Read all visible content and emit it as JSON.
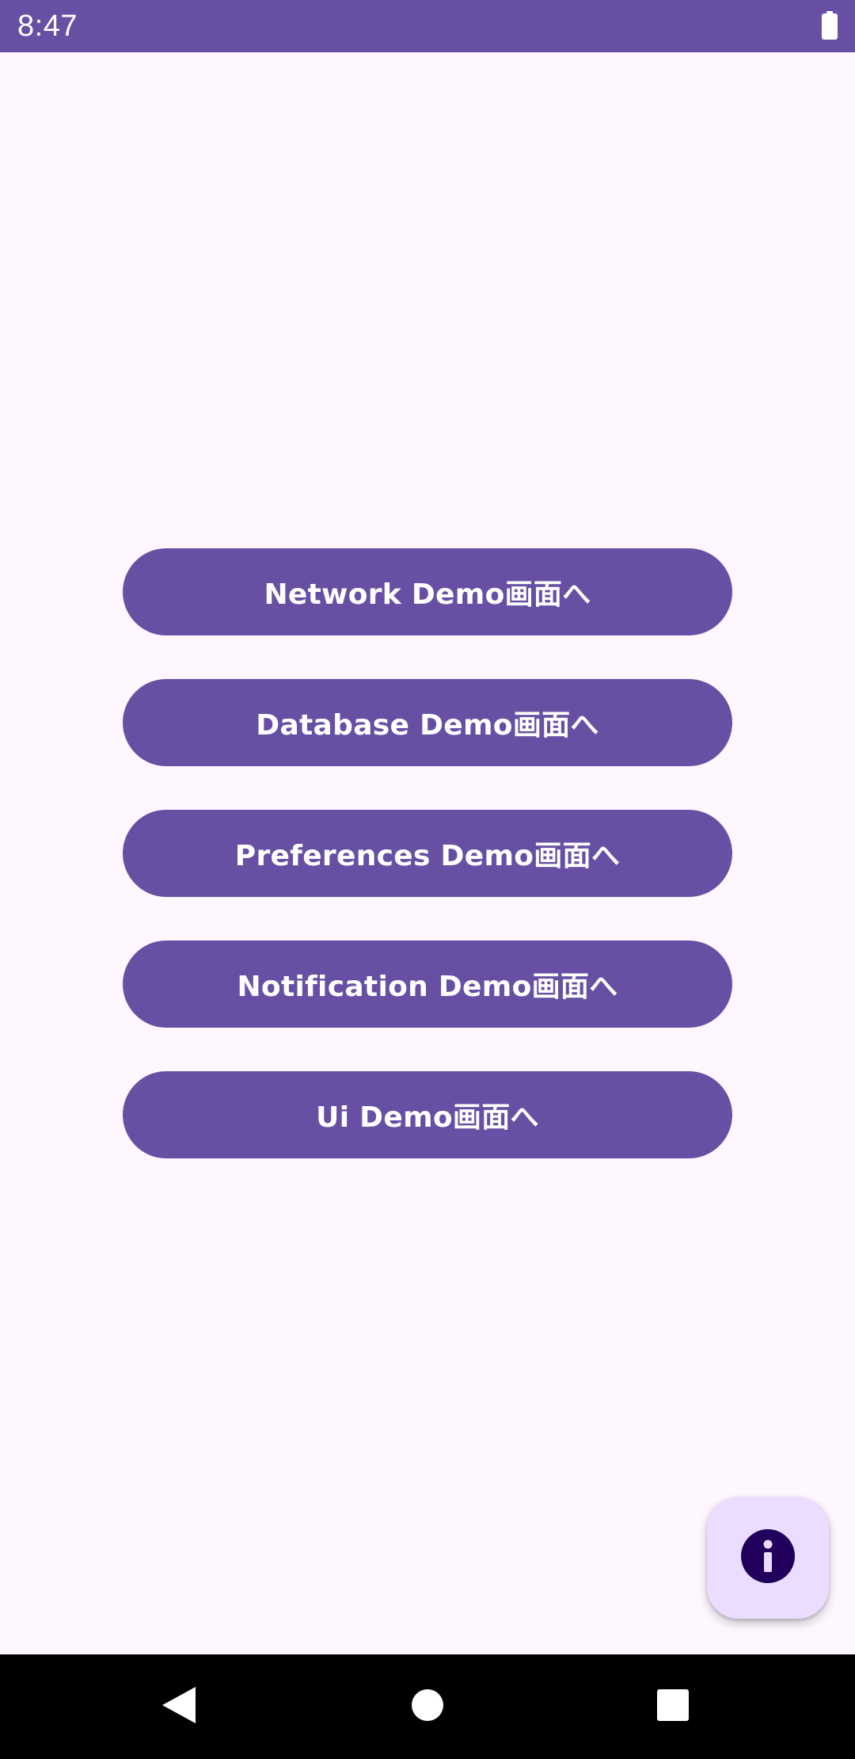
{
  "status_bar": {
    "time": "8:47",
    "battery_icon": "battery-full-icon"
  },
  "main": {
    "buttons": [
      {
        "label": "Network Demo画面へ"
      },
      {
        "label": "Database Demo画面へ"
      },
      {
        "label": "Preferences Demo画面へ"
      },
      {
        "label": "Notification Demo画面へ"
      },
      {
        "label": "Ui Demo画面へ"
      }
    ]
  },
  "fab": {
    "icon": "info-icon"
  },
  "navigation_bar": {
    "back_icon": "back-triangle-icon",
    "home_icon": "home-circle-icon",
    "recents_icon": "recents-square-icon"
  },
  "colors": {
    "primary": "#6750A4",
    "background": "#FEF7FF",
    "fab_container": "#EADDFF",
    "fab_icon": "#21005D",
    "nav_bar": "#000000"
  }
}
